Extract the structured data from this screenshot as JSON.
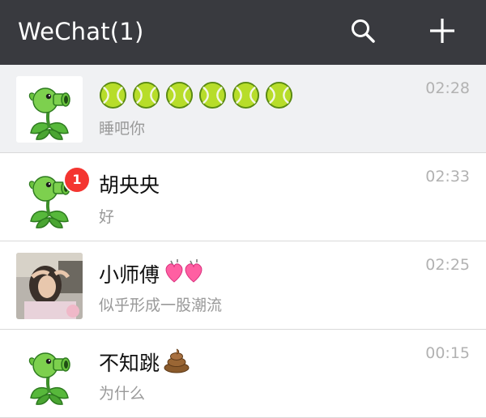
{
  "header": {
    "title": "WeChat(1)",
    "icons": [
      "search-icon",
      "plus-icon"
    ]
  },
  "chats": [
    {
      "name": "",
      "name_emoji": "tennis-ball x6",
      "preview": "睡吧你",
      "time": "02:28",
      "avatar": "peashooter",
      "unread": null,
      "active": true
    },
    {
      "name": "胡央央",
      "preview": "好",
      "time": "02:33",
      "avatar": "peashooter",
      "unread": "1",
      "active": false
    },
    {
      "name": "小师傅",
      "name_emoji": "sparkling-hearts",
      "preview": "似乎形成一股潮流",
      "time": "02:25",
      "avatar": "photo",
      "unread": null,
      "active": false
    },
    {
      "name": "不知跳",
      "name_emoji": "poop",
      "preview": "为什么",
      "time": "00:15",
      "avatar": "peashooter",
      "unread": null,
      "active": false
    }
  ],
  "colors": {
    "topbar": "#393a3f",
    "badge": "#f43530",
    "active_row": "#f0f1f3",
    "preview_text": "#999999",
    "time_text": "#b2b2b2"
  }
}
